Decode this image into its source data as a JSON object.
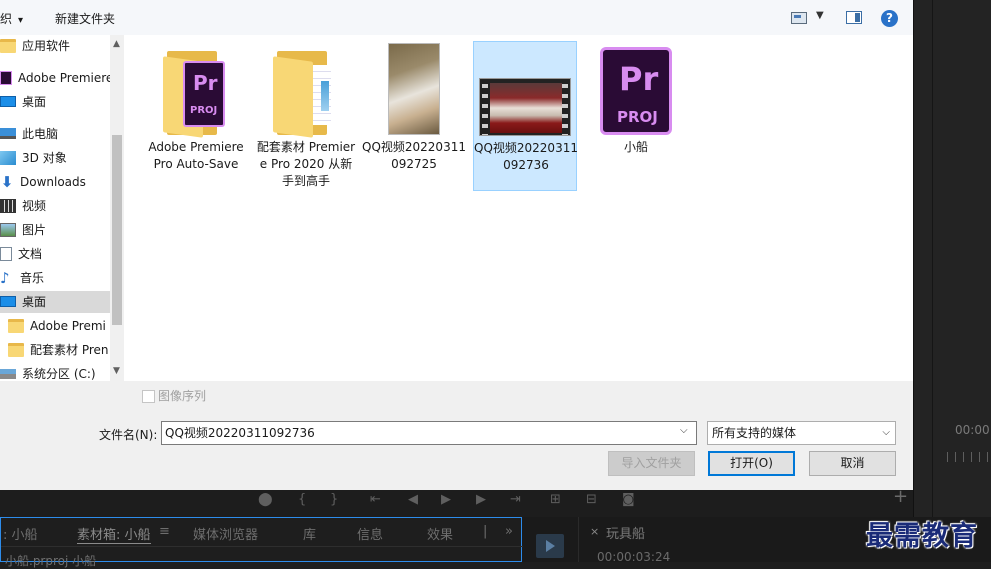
{
  "toolbar": {
    "organize_label": "织",
    "new_folder_label": "新建文件夹"
  },
  "nav": {
    "items": [
      {
        "label": "应用软件",
        "icon": "folder-icon"
      },
      {
        "label": "Adobe Premiere",
        "icon": "premiere-icon"
      },
      {
        "label": "桌面",
        "icon": "desktop-icon"
      },
      {
        "label": "此电脑",
        "icon": "computer-icon"
      },
      {
        "label": "3D 对象",
        "icon": "3d-objects-icon"
      },
      {
        "label": "Downloads",
        "icon": "download-icon"
      },
      {
        "label": "视频",
        "icon": "video-icon"
      },
      {
        "label": "图片",
        "icon": "pictures-icon"
      },
      {
        "label": "文档",
        "icon": "document-icon"
      },
      {
        "label": "音乐",
        "icon": "music-icon"
      },
      {
        "label": "桌面",
        "icon": "desktop-icon",
        "selected": true
      },
      {
        "label": "Adobe Premi",
        "icon": "folder-icon"
      },
      {
        "label": "配套素材 Pren",
        "icon": "folder-icon"
      },
      {
        "label": "系统分区 (C:)",
        "icon": "drive-icon"
      }
    ]
  },
  "files": [
    {
      "name": "Adobe Premiere Pro Auto-Save",
      "kind": "premiere-folder"
    },
    {
      "name": "配套素材 Premiere Pro 2020 从新手到高手",
      "kind": "folder"
    },
    {
      "name": "QQ视频20220311092725",
      "kind": "image"
    },
    {
      "name": "QQ视频20220311092736",
      "kind": "video",
      "selected": true
    },
    {
      "name": "小船",
      "kind": "premiere-project"
    }
  ],
  "image_sequence_label": "图像序列",
  "filename": {
    "label": "文件名(N):",
    "value": "QQ视频20220311092736"
  },
  "filetype": {
    "value": "所有支持的媒体"
  },
  "buttons": {
    "import_folder": "导入文件夹",
    "open": "打开(O)",
    "cancel": "取消"
  },
  "premiere": {
    "timecode_right": "00:00",
    "project_tabs": [
      ": 小船",
      "素材箱: 小船",
      "媒体浏览器",
      "库",
      "信息",
      "效果"
    ],
    "project_file": "小船.prproj 小船",
    "timeline_tab": "玩具船",
    "timeline_time": "00:00:03:24"
  },
  "watermark": "最需教育",
  "colors": {
    "accent": "#0078d7",
    "selection": "#cce8ff",
    "premiere_purple": "#d88cf0",
    "premiere_dark": "#2a0b35"
  }
}
